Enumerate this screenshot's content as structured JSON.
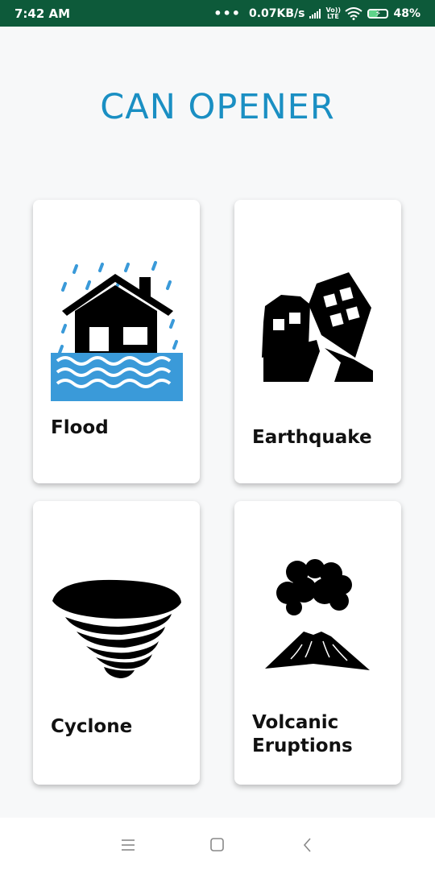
{
  "status_bar": {
    "time": "7:42 AM",
    "network_speed": "0.07KB/s",
    "lte_label": "Vo)) LTE",
    "battery_percent": "48%",
    "battery_level": 0.48
  },
  "app": {
    "title": "CAN OPENER"
  },
  "cards": [
    {
      "label": "Flood",
      "icon": "flood-icon"
    },
    {
      "label": "Earthquake",
      "icon": "earthquake-icon"
    },
    {
      "label": "Cyclone",
      "icon": "cyclone-icon"
    },
    {
      "label": "Volcanic Eruptions",
      "label_line1": "Volcanic",
      "label_line2": "Eruptions",
      "icon": "volcano-icon"
    }
  ],
  "nav_bar": {
    "items": [
      "menu-icon",
      "home-icon",
      "back-icon"
    ]
  },
  "colors": {
    "status_bar": "#0d5a3a",
    "title": "#1a8fc3",
    "flood_water": "#3a9ad9"
  }
}
